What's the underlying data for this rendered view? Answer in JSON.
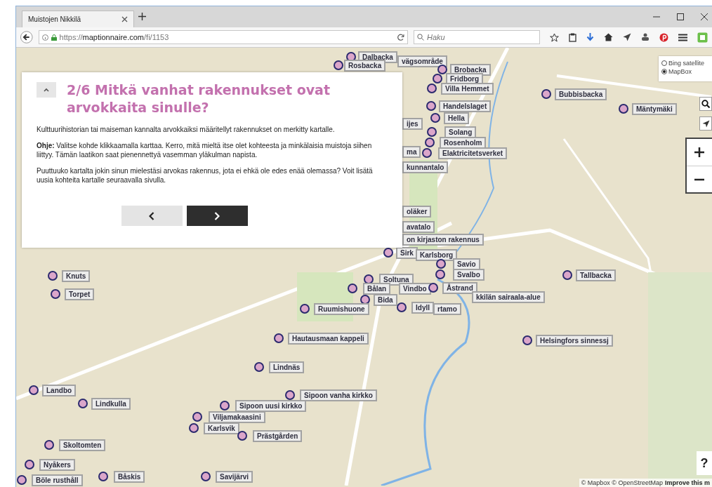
{
  "browser": {
    "tab": {
      "title": "Muistojen Nikkilä",
      "selected": true
    },
    "address": "https://**maptionnaire.com**/fi/1153",
    "search": {
      "placeholder": "Haku"
    }
  },
  "dialog": {
    "title": "2/6 Mitkä vanhat rakennukset ovat arvokkaita sinulle?",
    "paragraphs": [
      "Kulttuurihistorian tai maiseman kannalta arvokkaiksi määritellyt rakennukset on merkitty kartalle.",
      "**Ohje:** Valitse kohde klikkaamalla karttaa. Kerro, mitä mieltä itse olet kohteesta ja minkälaisia muistoja siihen liittyy. Tämän laatikon saat pienennettyä vasemman yläkulman napista.",
      "Puuttuuko kartalta jokin sinun mielestäsi arvokas rakennus, jota ei ehkä ole edes enää olemassa? Voit lisätä uusia kohteita kartalle seuraavalla sivulla."
    ]
  },
  "layers": [
    {
      "label": "Bing satellite",
      "selected": false
    },
    {
      "label": "MapBox",
      "selected": true
    }
  ],
  "markers": [
    {
      "kind": "pin",
      "label": "Dalbacka"
    },
    {
      "kind": "label",
      "label": "vägsområde"
    },
    {
      "kind": "pin",
      "label": "Rosbacka"
    },
    {
      "kind": "pin",
      "label": "Brobacka"
    },
    {
      "kind": "pin",
      "label": "Fridborg"
    },
    {
      "kind": "pin",
      "label": "Villa Hemmet"
    },
    {
      "kind": "pin",
      "label": "Handelslaget"
    },
    {
      "kind": "pin",
      "label": "Hella"
    },
    {
      "kind": "pin",
      "label": "Solang"
    },
    {
      "kind": "pin",
      "label": "Rosenholm"
    },
    {
      "kind": "pin",
      "label": "Elaktricitetsverket"
    },
    {
      "kind": "pin",
      "label": "Bubbisbacka"
    },
    {
      "kind": "pin",
      "label": "Mäntymäki"
    },
    {
      "kind": "label",
      "label": "ijes"
    },
    {
      "kind": "label",
      "label": "ma"
    },
    {
      "kind": "label",
      "label": "kunnantalo"
    },
    {
      "kind": "label",
      "label": "oläker"
    },
    {
      "kind": "label",
      "label": "avatalo"
    },
    {
      "kind": "label",
      "label": "on kirjaston rakennus"
    },
    {
      "kind": "pin",
      "label": "Sirk"
    },
    {
      "kind": "label",
      "label": "Karlsborg"
    },
    {
      "kind": "pin",
      "label": "Savio"
    },
    {
      "kind": "pin",
      "label": "Svalbo"
    },
    {
      "kind": "pin",
      "label": "Soltuna"
    },
    {
      "kind": "pin",
      "label": "Bålan"
    },
    {
      "kind": "label",
      "label": "Vindbo"
    },
    {
      "kind": "pin",
      "label": "Åstrand"
    },
    {
      "kind": "label",
      "label": "kkilän sairaala-alue"
    },
    {
      "kind": "pin",
      "label": "Bida"
    },
    {
      "kind": "pin",
      "label": "Ruumishuone"
    },
    {
      "kind": "pin",
      "label": "Idyll"
    },
    {
      "kind": "label",
      "label": "rtamo"
    },
    {
      "kind": "pin",
      "label": "Hautausmaan kappeli"
    },
    {
      "kind": "pin",
      "label": "Tallbacka"
    },
    {
      "kind": "pin",
      "label": "Helsingfors sinnessj"
    },
    {
      "kind": "pin",
      "label": "Lindnäs"
    },
    {
      "kind": "pin",
      "label": "Sipoon vanha kirkko"
    },
    {
      "kind": "pin",
      "label": "Sipoon uusi kirkko"
    },
    {
      "kind": "pin",
      "label": "Viljamakaasini"
    },
    {
      "kind": "pin",
      "label": "Karlsvik"
    },
    {
      "kind": "pin",
      "label": "Prästgården"
    },
    {
      "kind": "pin",
      "label": "Knuts"
    },
    {
      "kind": "pin",
      "label": "Torpet"
    },
    {
      "kind": "pin",
      "label": "Landbo"
    },
    {
      "kind": "pin",
      "label": "Lindkulla"
    },
    {
      "kind": "pin",
      "label": "Skoltomten"
    },
    {
      "kind": "pin",
      "label": "Nyåkers"
    },
    {
      "kind": "pin",
      "label": "Böle rusthåll"
    },
    {
      "kind": "pin",
      "label": "Båskis"
    },
    {
      "kind": "pin",
      "label": "Savijärvi"
    }
  ],
  "help": "?",
  "attribution": {
    "text": "© Mapbox © OpenStreetMap",
    "link": "Improve this m"
  }
}
